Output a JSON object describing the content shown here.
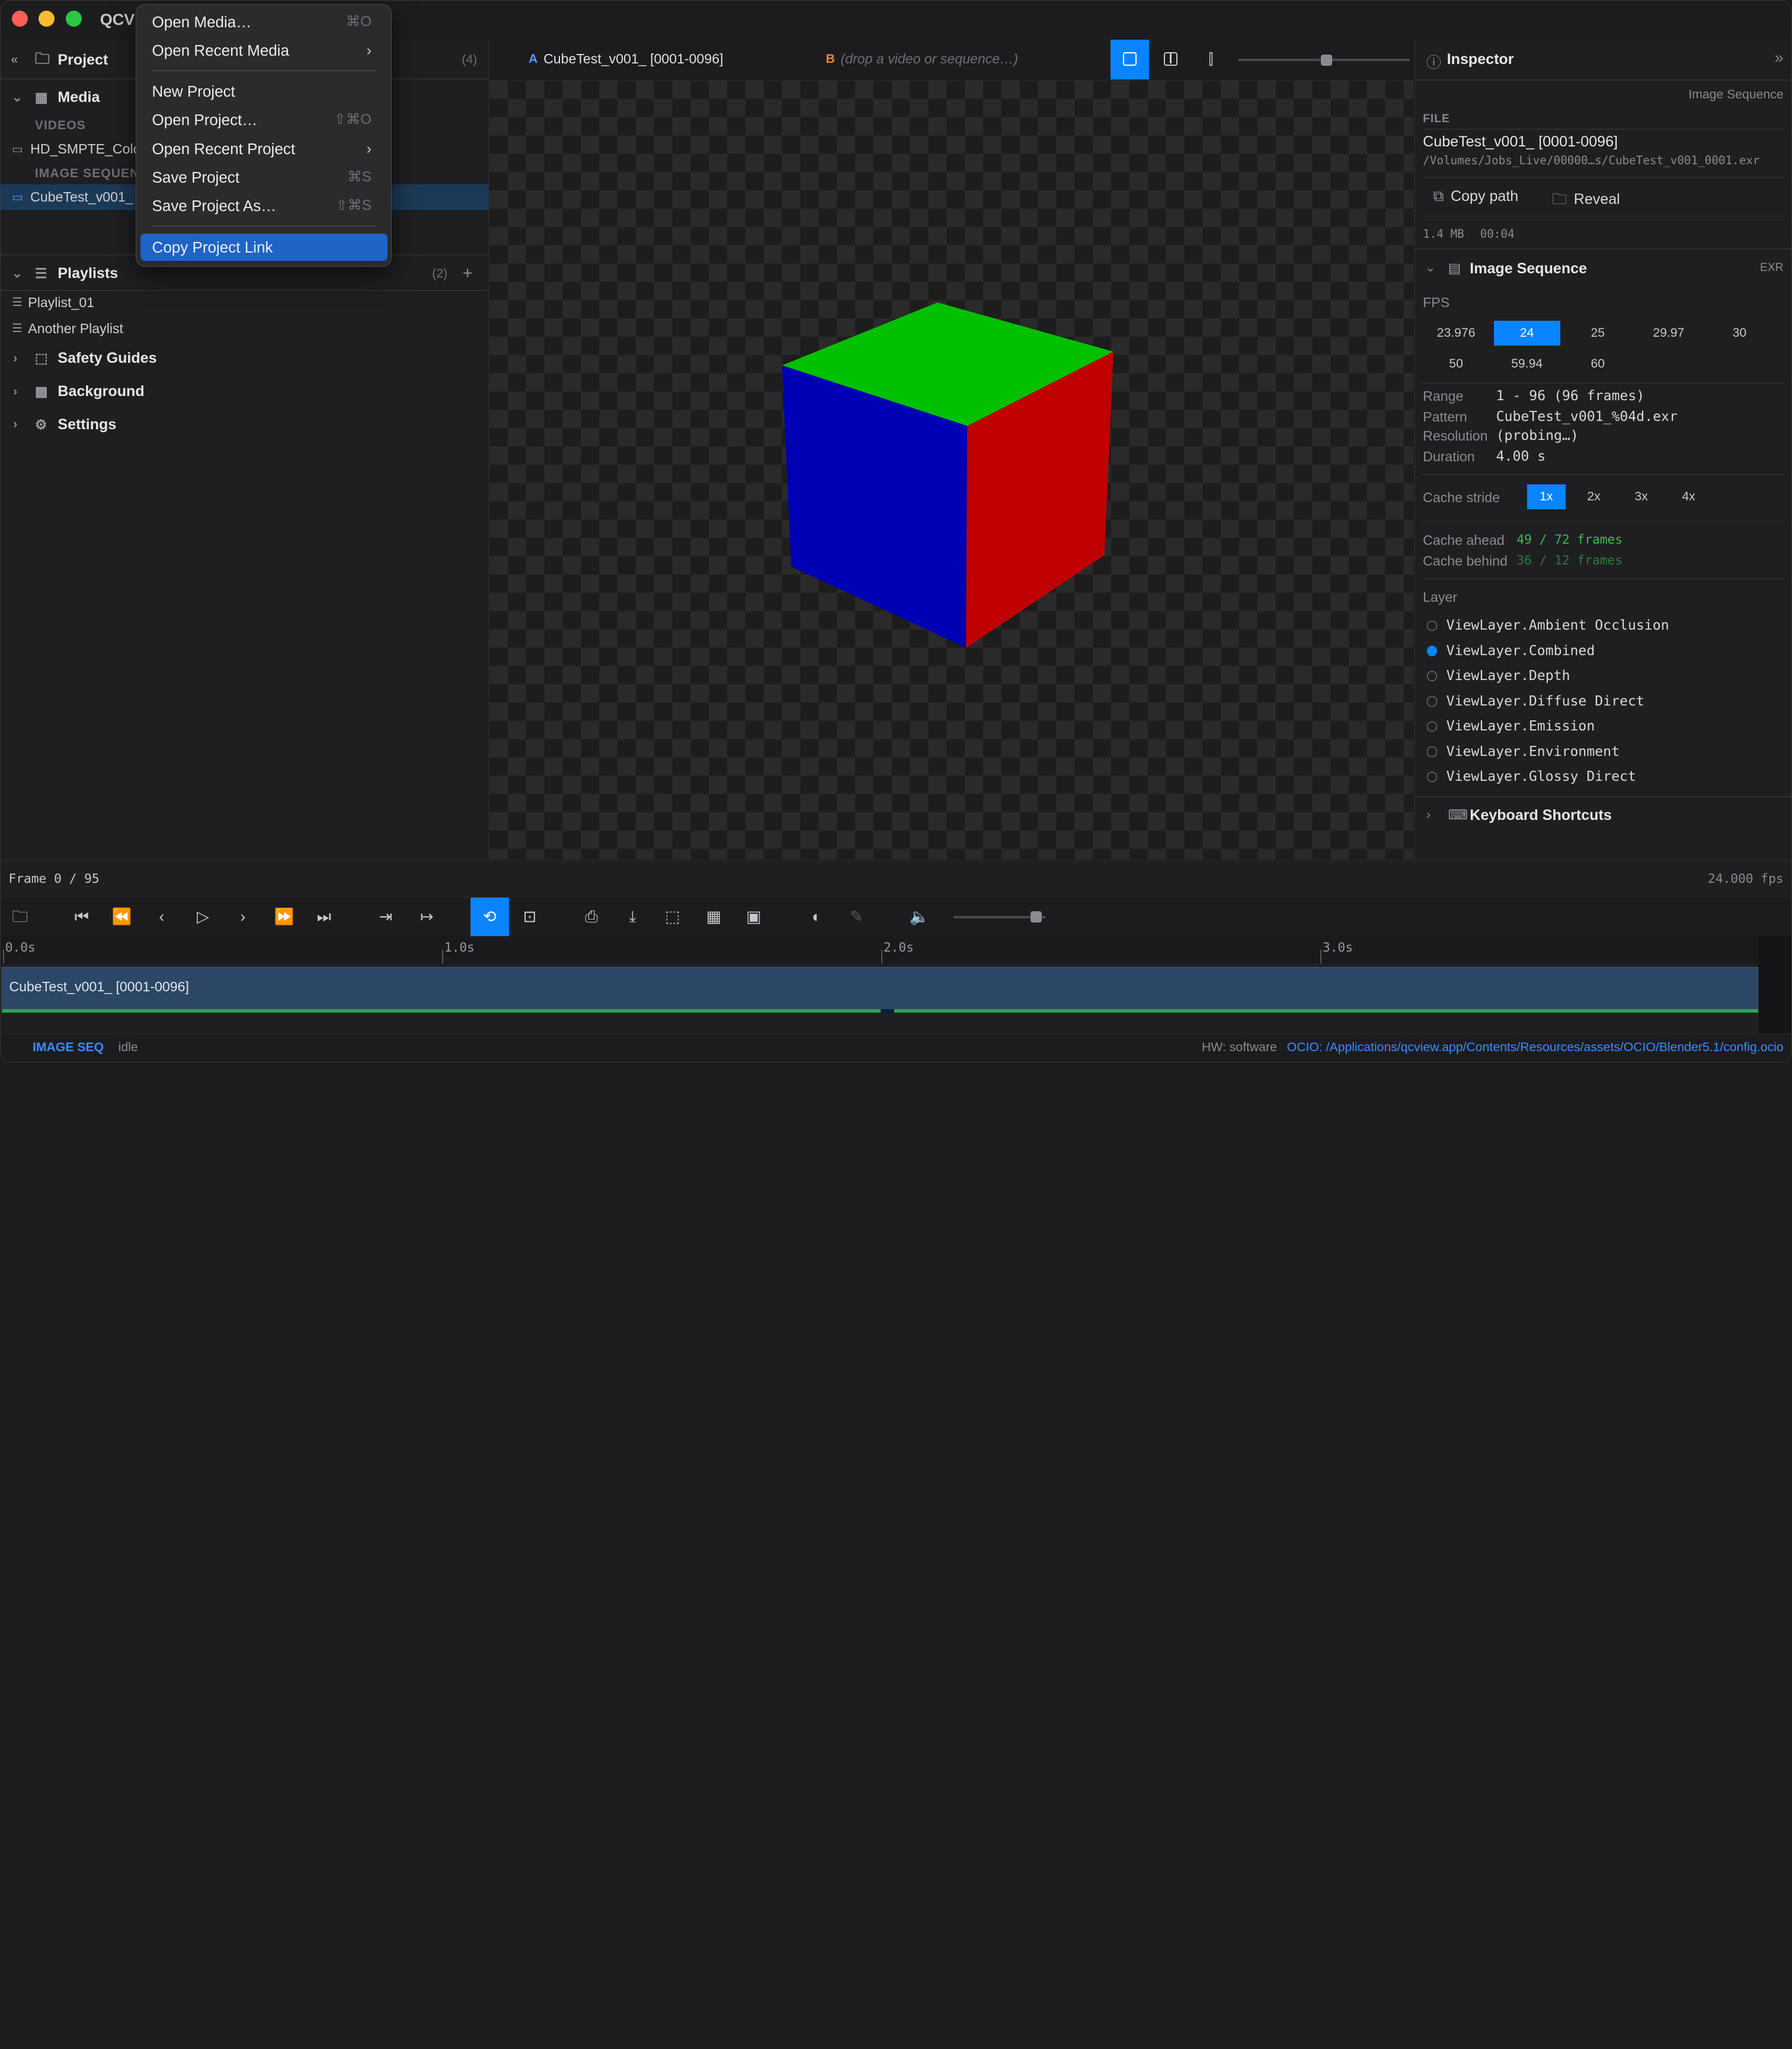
{
  "app": {
    "name": "QCV"
  },
  "menu": {
    "items": [
      {
        "label": "Open Media…",
        "shortcut": "⌘O",
        "submenu": false
      },
      {
        "label": "Open Recent Media",
        "shortcut": "",
        "submenu": true
      },
      {
        "label": "New Project",
        "shortcut": "",
        "submenu": false
      },
      {
        "label": "Open Project…",
        "shortcut": "⇧⌘O",
        "submenu": false
      },
      {
        "label": "Open Recent Project",
        "shortcut": "",
        "submenu": true
      },
      {
        "label": "Save Project",
        "shortcut": "⌘S",
        "submenu": false
      },
      {
        "label": "Save Project As…",
        "shortcut": "⇧⌘S",
        "submenu": false
      },
      {
        "label": "Copy Project Link",
        "shortcut": "",
        "submenu": false
      }
    ]
  },
  "left": {
    "project": {
      "title": "Project",
      "count": "(4)"
    },
    "media": {
      "title": "Media",
      "videos_label": "VIDEOS",
      "video_item": "HD_SMPTE_Colo",
      "imgseq_label": "IMAGE SEQUEN",
      "imgseq_item": "CubeTest_v001_ ["
    },
    "playlists": {
      "title": "Playlists",
      "count": "(2)",
      "add": "+",
      "items": [
        "Playlist_01",
        "Another Playlist"
      ]
    },
    "sections": [
      "Safety Guides",
      "Background",
      "Settings"
    ]
  },
  "viewer": {
    "a_tag": "A",
    "a_name": "CubeTest_v001_ [0001-0096]",
    "b_tag": "B",
    "b_placeholder": "(drop a video or sequence…)"
  },
  "inspector": {
    "title": "Inspector",
    "type_label": "Image Sequence",
    "file_label": "FILE",
    "file_name": "CubeTest_v001_ [0001-0096]",
    "file_path": "/Volumes/Jobs_Live/00000…s/CubeTest_v001_0001.exr",
    "copy_path": "Copy path",
    "reveal": "Reveal",
    "size": "1.4 MB",
    "dur_short": "00:04",
    "section_title": "Image Sequence",
    "section_badge": "EXR",
    "fps_label": "FPS",
    "fps_options": [
      "23.976",
      "24",
      "25",
      "29.97",
      "30",
      "50",
      "59.94",
      "60"
    ],
    "fps_selected": "24",
    "range_label": "Range",
    "range_value": "1 - 96 (96 frames)",
    "pattern_label": "Pattern",
    "pattern_value": "CubeTest_v001_%04d.exr",
    "resolution_label": "Resolution",
    "resolution_value": "(probing…)",
    "duration_label": "Duration",
    "duration_value": "4.00 s",
    "stride_label": "Cache stride",
    "stride_options": [
      "1x",
      "2x",
      "3x",
      "4x"
    ],
    "stride_selected": "1x",
    "ahead_label": "Cache ahead",
    "ahead_value": "49 / 72 frames",
    "behind_label": "Cache behind",
    "behind_value": "36 / 12 frames",
    "layer_label": "Layer",
    "layers": [
      "ViewLayer.Ambient Occlusion",
      "ViewLayer.Combined",
      "ViewLayer.Depth",
      "ViewLayer.Diffuse Direct",
      "ViewLayer.Emission",
      "ViewLayer.Environment",
      "ViewLayer.Glossy Direct"
    ],
    "layer_selected": "ViewLayer.Combined",
    "shortcuts": "Keyboard Shortcuts"
  },
  "timeline": {
    "frame_label": "Frame 0 / 95",
    "fps_readout": "24.000 fps",
    "ticks": [
      "0.0s",
      "1.0s",
      "2.0s",
      "3.0s"
    ],
    "clip_name": "CubeTest_v001_ [0001-0096]",
    "volume_level": 0.9
  },
  "status": {
    "mode": "IMAGE SEQ",
    "state": "idle",
    "hw": "HW: software",
    "ocio": "OCIO: /Applications/qcview.app/Contents/Resources/assets/OCIO/Blender5.1/config.ocio"
  },
  "colors": {
    "accent": "#0a84ff",
    "menu_highlight": "#1f63c4",
    "cube_top": "#00c000",
    "cube_left": "#0000b4",
    "cube_right": "#c00000",
    "cache_green": "#2ea44f"
  }
}
